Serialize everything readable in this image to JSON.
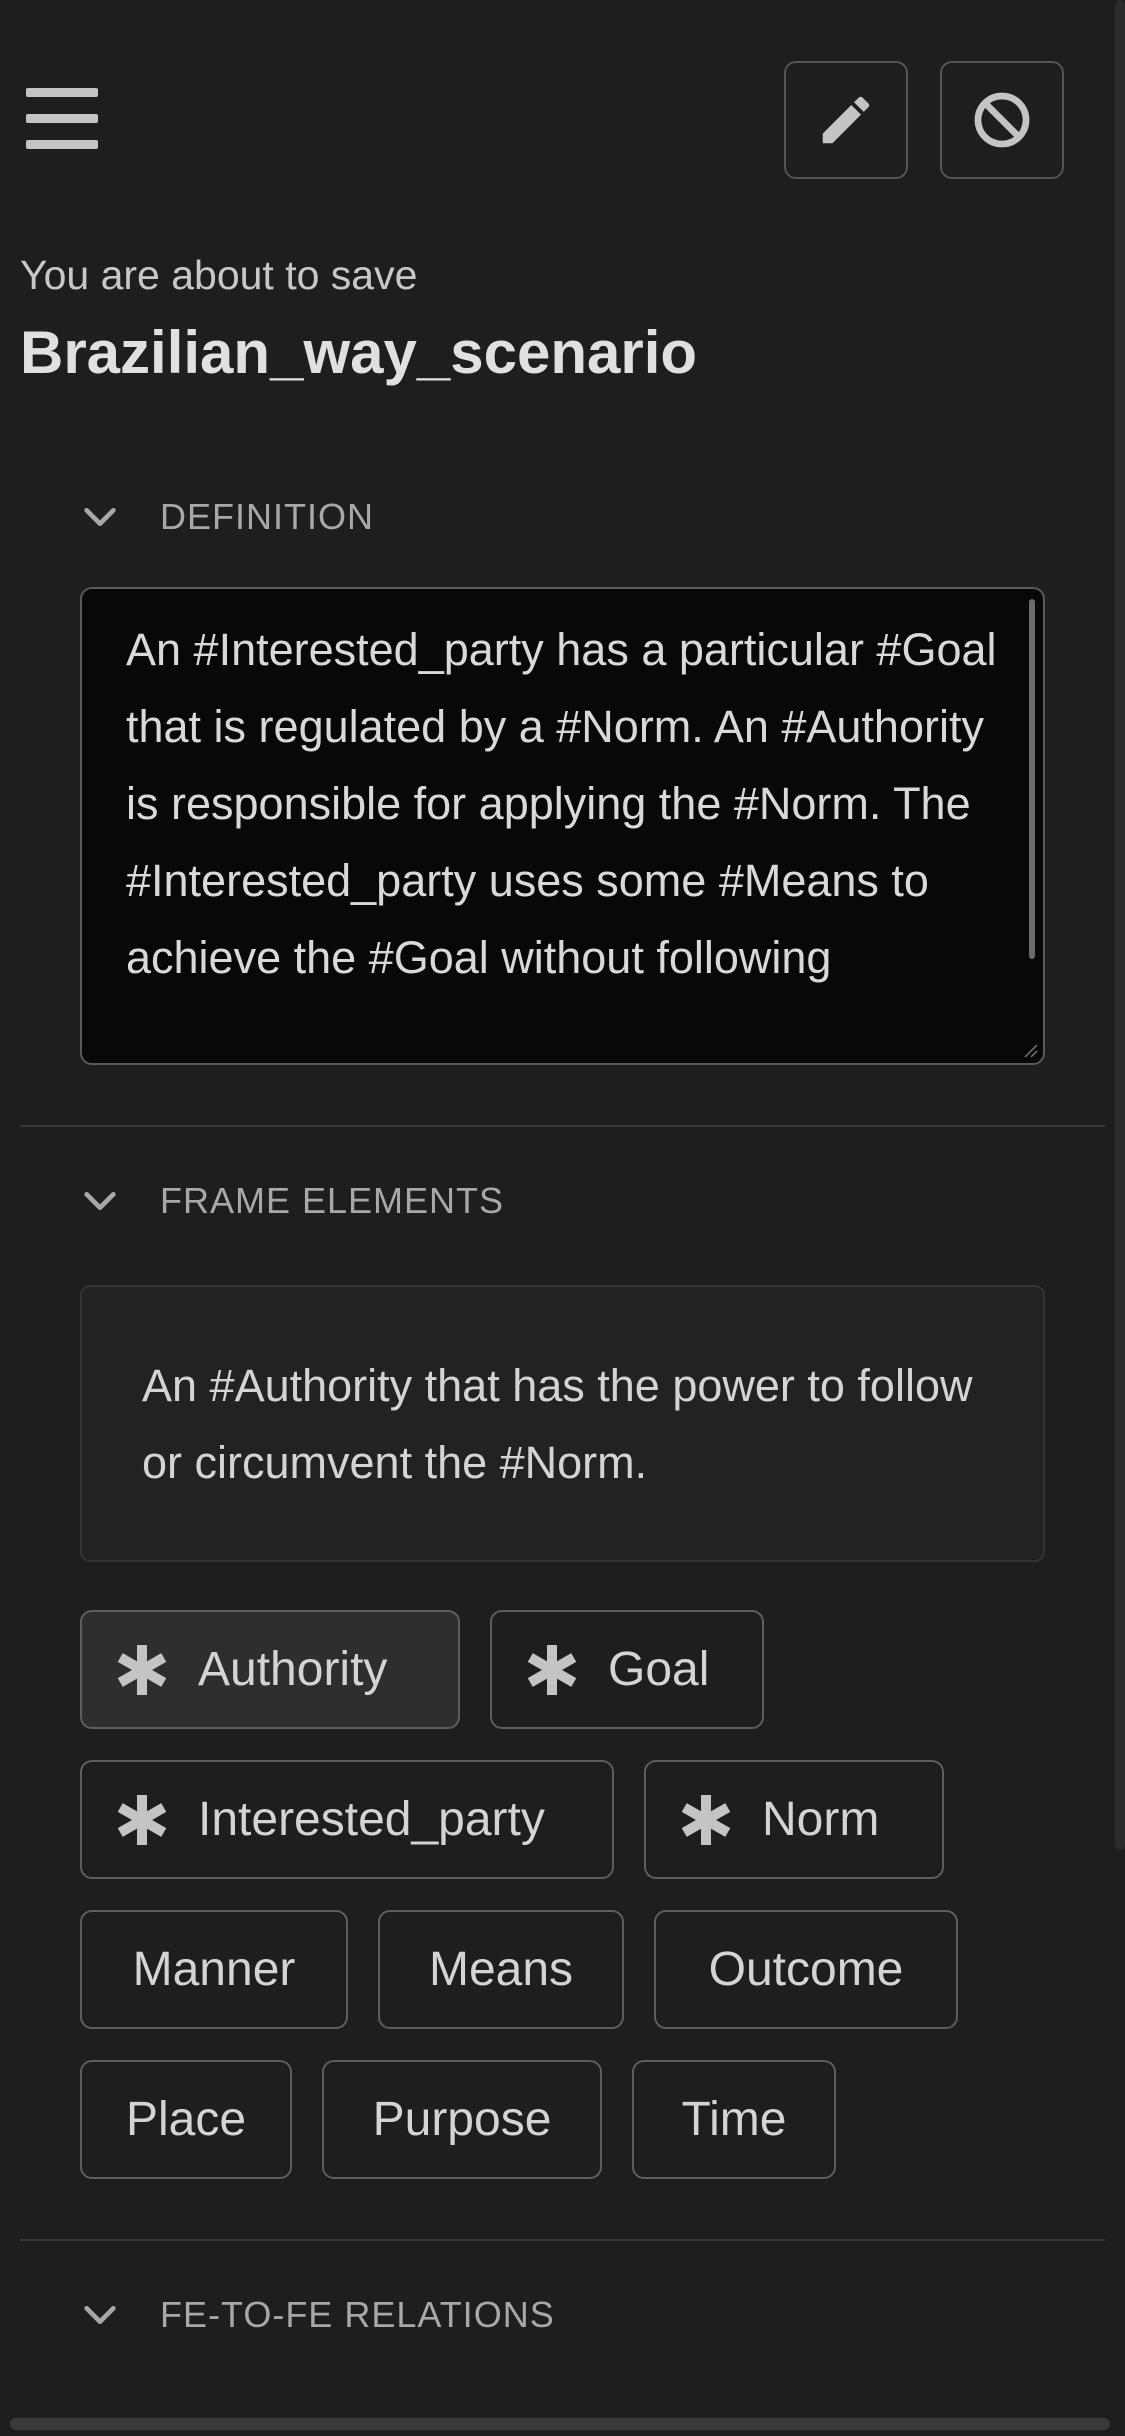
{
  "header": {
    "menu_icon": "hamburger-menu-icon",
    "edit_icon": "pencil-icon",
    "cancel_icon": "block-icon",
    "subtitle": "You are about to save",
    "title": "Brazilian_way_scenario"
  },
  "sections": {
    "definition": {
      "label": "DEFINITION",
      "text": "An #Interested_party has a particular #Goal that is regulated by a #Norm. An #Authority is responsible for applying the #Norm. The #Interested_party uses some #Means to achieve the #Goal without following"
    },
    "frame_elements": {
      "label": "FRAME ELEMENTS",
      "description": "An #Authority that has the power to follow or circumvent the #Norm.",
      "core_elements": [
        {
          "label": "Authority",
          "icon": "asterisk-icon"
        },
        {
          "label": "Goal",
          "icon": "asterisk-icon"
        },
        {
          "label": "Interested_party",
          "icon": "asterisk-icon"
        },
        {
          "label": "Norm",
          "icon": "asterisk-icon"
        }
      ],
      "non_core_elements": [
        {
          "label": "Manner"
        },
        {
          "label": "Means"
        },
        {
          "label": "Outcome"
        },
        {
          "label": "Place"
        },
        {
          "label": "Purpose"
        },
        {
          "label": "Time"
        }
      ]
    },
    "fe_relations": {
      "label": "FE-TO-FE RELATIONS"
    }
  },
  "colors": {
    "background": "#1e1e1e",
    "text": "#d6d6d6",
    "border": "#5e5e5e"
  }
}
